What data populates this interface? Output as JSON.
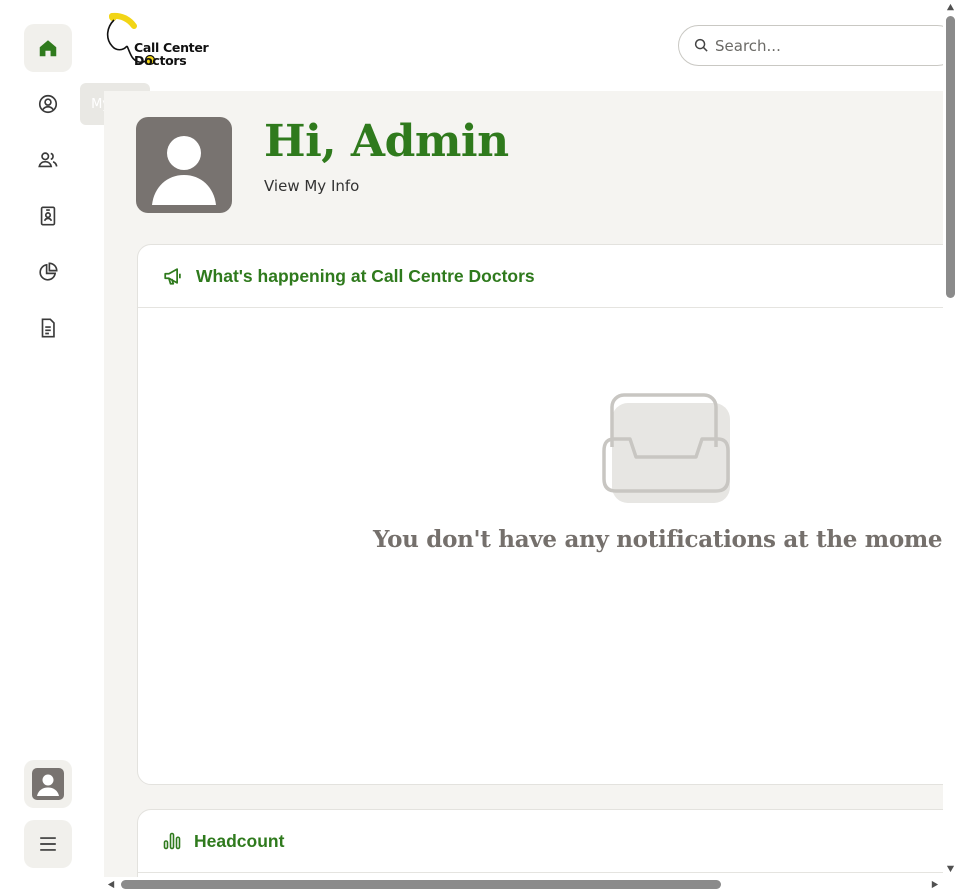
{
  "brand": {
    "logo_line1": "Call Center",
    "logo_line2": "Doctors",
    "accent_color": "#2f7a1d",
    "logo_yellow": "#f2d516"
  },
  "sidebar": {
    "items": [
      {
        "name": "home",
        "icon": "home-icon",
        "active": true
      },
      {
        "name": "my-info",
        "icon": "user-circle-icon",
        "tooltip": "My Info"
      },
      {
        "name": "people",
        "icon": "users-icon"
      },
      {
        "name": "directory",
        "icon": "id-badge-icon"
      },
      {
        "name": "reports",
        "icon": "pie-chart-icon"
      },
      {
        "name": "documents",
        "icon": "document-icon"
      }
    ],
    "bottom": [
      {
        "name": "profile",
        "icon": "avatar-icon"
      },
      {
        "name": "menu",
        "icon": "hamburger-icon"
      }
    ]
  },
  "tooltip": {
    "text": "My Info"
  },
  "search": {
    "placeholder": "Search..."
  },
  "header": {
    "greeting": "Hi, Admin",
    "link": "View My Info"
  },
  "cards": {
    "whats_happening": {
      "title": "What's happening at Call Centre Doctors",
      "empty_message": "You don't have any notifications at the moment."
    },
    "headcount": {
      "title": "Headcount"
    }
  }
}
